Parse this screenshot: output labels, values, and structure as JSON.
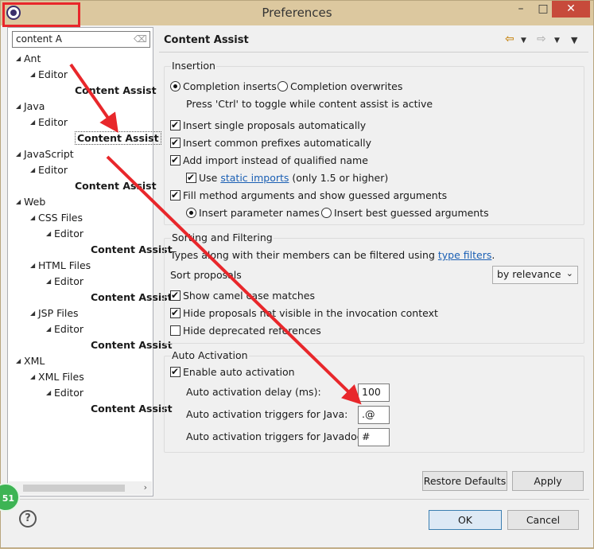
{
  "window": {
    "title": "Preferences",
    "minimize": "–",
    "maximize": "□",
    "close": "✕"
  },
  "filter": {
    "value": "content A",
    "clear_icon": "eraser-icon"
  },
  "tree": [
    {
      "label": "Ant",
      "level": 0,
      "twisty": "◢"
    },
    {
      "label": "Editor",
      "level": 1,
      "twisty": "◢"
    },
    {
      "label": "Content Assist",
      "level": 2,
      "bold": true
    },
    {
      "label": "Java",
      "level": 0,
      "twisty": "◢"
    },
    {
      "label": "Editor",
      "level": 1,
      "twisty": "◢"
    },
    {
      "label": "Content Assist",
      "level": 2,
      "bold": true,
      "selected": true
    },
    {
      "label": "JavaScript",
      "level": 0,
      "twisty": "◢"
    },
    {
      "label": "Editor",
      "level": 1,
      "twisty": "◢"
    },
    {
      "label": "Content Assist",
      "level": 2,
      "bold": true
    },
    {
      "label": "Web",
      "level": 0,
      "twisty": "◢"
    },
    {
      "label": "CSS Files",
      "level": 1,
      "twisty": "◢"
    },
    {
      "label": "Editor",
      "level": 2,
      "twisty": "◢"
    },
    {
      "label": "Content Assist",
      "level": 3,
      "bold": true
    },
    {
      "label": "HTML Files",
      "level": 1,
      "twisty": "◢"
    },
    {
      "label": "Editor",
      "level": 2,
      "twisty": "◢"
    },
    {
      "label": "Content Assist",
      "level": 3,
      "bold": true
    },
    {
      "label": "JSP Files",
      "level": 1,
      "twisty": "◢"
    },
    {
      "label": "Editor",
      "level": 2,
      "twisty": "◢"
    },
    {
      "label": "Content Assist",
      "level": 3,
      "bold": true
    },
    {
      "label": "XML",
      "level": 0,
      "twisty": "◢"
    },
    {
      "label": "XML Files",
      "level": 1,
      "twisty": "◢"
    },
    {
      "label": "Editor",
      "level": 2,
      "twisty": "◢"
    },
    {
      "label": "Content Assist",
      "level": 3,
      "bold": true
    }
  ],
  "page": {
    "title": "Content Assist",
    "back_icon": "back-arrow-icon",
    "forward_icon": "forward-arrow-icon",
    "menu_icon": "chevron-down-icon"
  },
  "insertion": {
    "label": "Insertion",
    "completion_inserts": "Completion inserts",
    "completion_overwrites": "Completion overwrites",
    "toggle_hint": "Press 'Ctrl' to toggle while content assist is active",
    "single_proposals": "Insert single proposals automatically",
    "common_prefixes": "Insert common prefixes automatically",
    "add_import": "Add import instead of qualified name",
    "use_prefix": "Use",
    "static_imports": "static imports",
    "use_suffix": "(only 1.5 or higher)",
    "fill_args": "Fill method arguments and show guessed arguments",
    "insert_param_names": "Insert parameter names",
    "insert_best_guess": "Insert best guessed arguments"
  },
  "sorting": {
    "label": "Sorting and Filtering",
    "types_text": "Types along with their members can be filtered using",
    "type_filters": "type filters",
    "period": ".",
    "sort_label": "Sort proposals",
    "sort_value": "by relevance",
    "camel_case": "Show camel case matches",
    "hide_not_visible": "Hide proposals not visible in the invocation context",
    "hide_deprecated": "Hide deprecated references"
  },
  "auto": {
    "label": "Auto Activation",
    "enable": "Enable auto activation",
    "delay_label": "Auto activation delay (ms):",
    "delay_value": "100",
    "java_label": "Auto activation triggers for Java:",
    "java_value": ".@",
    "javadoc_label": "Auto activation triggers for Javadoc:",
    "javadoc_value": "#"
  },
  "buttons": {
    "restore_defaults": "Restore Defaults",
    "apply": "Apply",
    "ok": "OK",
    "cancel": "Cancel",
    "help": "?"
  },
  "badge": {
    "text": "51"
  },
  "colors": {
    "annotation": "#e8272b",
    "titlebar": "#dcc89f",
    "link": "#1a5fb4"
  }
}
